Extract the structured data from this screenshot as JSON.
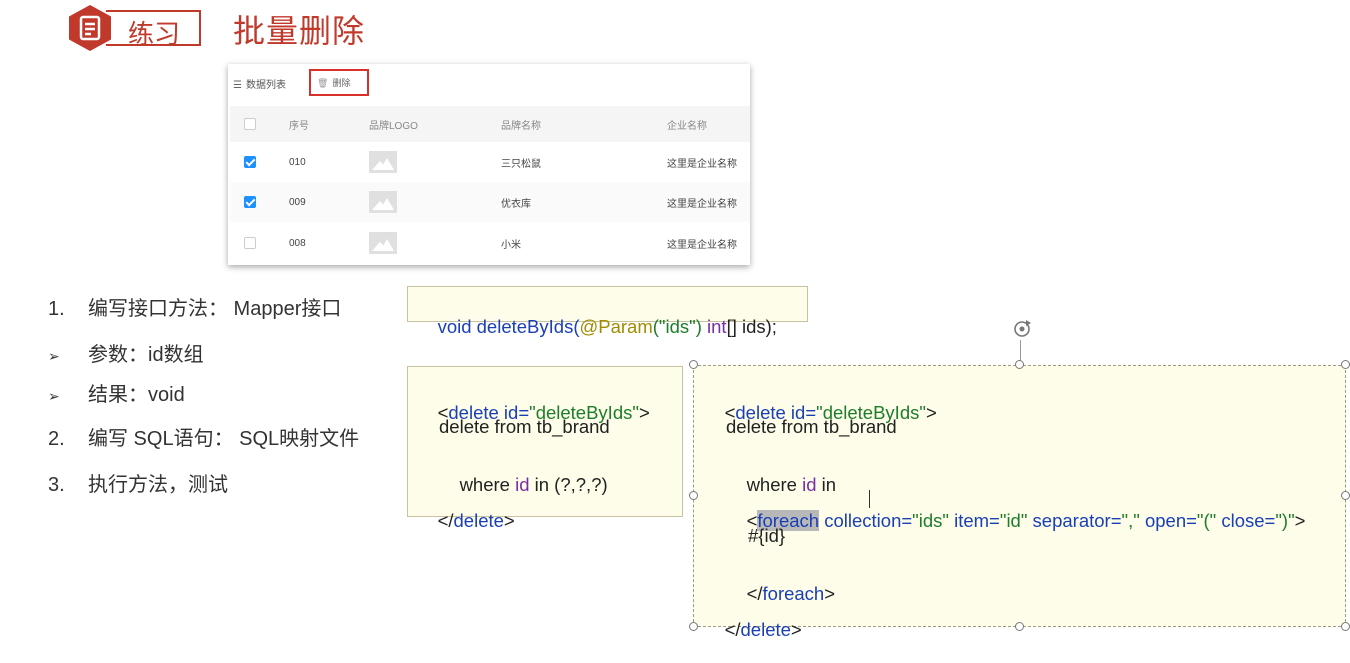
{
  "header": {
    "badge_label": "练习",
    "title": "批量删除"
  },
  "toolbar": {
    "list_label": "数据列表",
    "delete_label": "删除"
  },
  "table": {
    "columns": [
      "序号",
      "品牌LOGO",
      "品牌名称",
      "企业名称"
    ],
    "rows": [
      {
        "checked": true,
        "no": "010",
        "brand": "三只松鼠",
        "company": "这里是企业名称"
      },
      {
        "checked": true,
        "no": "009",
        "brand": "优衣库",
        "company": "这里是企业名称"
      },
      {
        "checked": false,
        "no": "008",
        "brand": "小米",
        "company": "这里是企业名称"
      }
    ]
  },
  "steps": [
    {
      "marker": "1.",
      "text": "编写接口方法： Mapper接口"
    },
    {
      "marker": "➢",
      "text": "参数：id数组"
    },
    {
      "marker": "➢",
      "text": "结果：void"
    },
    {
      "marker": "2.",
      "text": "编写 SQL语句： SQL映射文件"
    },
    {
      "marker": "3.",
      "text": "执行方法，测试"
    }
  ],
  "code_signature": {
    "void": "void ",
    "method": "deleteByIds(",
    "annotation": "@Param",
    "arg": "(\"ids\") ",
    "type": "int",
    "rest": "[] ids);"
  },
  "code_simple": {
    "l1_open": "<",
    "l1_tag": "delete",
    "l1_attr": " id=",
    "l1_val": "\"deleteByIds\"",
    "l1_close": ">",
    "l2": "delete from tb_brand",
    "l3_a": "where ",
    "l3_id": "id",
    "l3_b": " in (?,?,?)",
    "l4_open": "</",
    "l4_tag": "delete",
    "l4_close": ">"
  },
  "code_foreach": {
    "l1_open": "<",
    "l1_tag": "delete",
    "l1_attr": " id=",
    "l1_val": "\"deleteByIds\"",
    "l1_close": ">",
    "l2": "delete from tb_brand",
    "l3_a": "where ",
    "l3_id": "id",
    "l3_b": " in",
    "l4_open": "<",
    "l4_tag": "foreach",
    "l4_a1": " collection=",
    "l4_v1": "\"ids\"",
    "l4_a2": " item=",
    "l4_v2": "\"id\"",
    "l4_a3": " separator=",
    "l4_v3": "\",\"",
    "l4_a4": " open=",
    "l4_v4": "\"(\"",
    "l4_a5": " close=",
    "l4_v5": "\")\"",
    "l4_close": ">",
    "l5": "#{id}",
    "l6_open": "</",
    "l6_tag": "foreach",
    "l6_close": ">",
    "l7_open": "</",
    "l7_tag": "delete",
    "l7_close": ">"
  },
  "colors": {
    "accent_red": "#c0392b",
    "checkbox_blue": "#1e90ff",
    "code_bg": "#fdfdea"
  }
}
